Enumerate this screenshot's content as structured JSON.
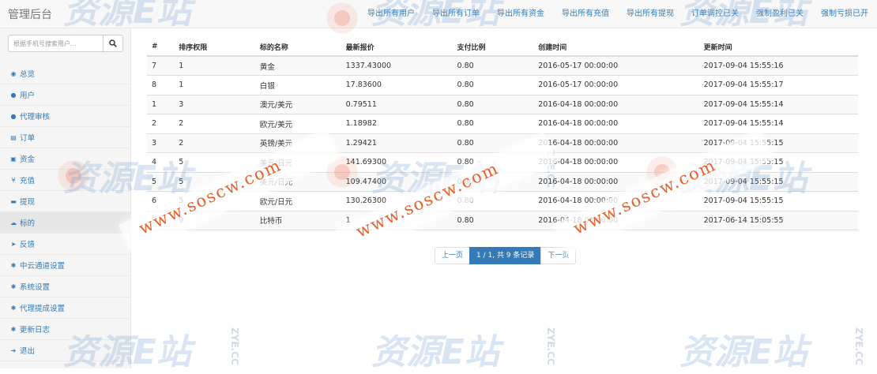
{
  "app": {
    "title": "管理后台"
  },
  "topnav": [
    {
      "label": "导出所有用户"
    },
    {
      "label": "导出所有订单"
    },
    {
      "label": "导出所有资金"
    },
    {
      "label": "导出所有充值"
    },
    {
      "label": "导出所有提现"
    },
    {
      "label": "订单调控已关"
    },
    {
      "label": "强制盈利已关"
    },
    {
      "label": "强制亏损已开"
    }
  ],
  "search": {
    "placeholder": "根据手机号搜索用户...",
    "icon": "search-icon"
  },
  "sidebar": {
    "items": [
      {
        "label": "总览",
        "icon": "dashboard-icon",
        "glyph": "◉"
      },
      {
        "label": "用户",
        "icon": "user-icon",
        "glyph": "●"
      },
      {
        "label": "代理审核",
        "icon": "user-icon",
        "glyph": "●"
      },
      {
        "label": "订单",
        "icon": "list-icon",
        "glyph": "▤"
      },
      {
        "label": "资金",
        "icon": "money-icon",
        "glyph": "▣"
      },
      {
        "label": "充值",
        "icon": "yen-icon",
        "glyph": "¥"
      },
      {
        "label": "提现",
        "icon": "briefcase-icon",
        "glyph": "▬"
      },
      {
        "label": "标的",
        "icon": "cloud-icon",
        "glyph": "☁"
      },
      {
        "label": "反馈",
        "icon": "send-icon",
        "glyph": "➤"
      },
      {
        "label": "中云通道设置",
        "icon": "settings-icon",
        "glyph": "✱"
      },
      {
        "label": "系统设置",
        "icon": "settings-icon",
        "glyph": "✱"
      },
      {
        "label": "代理提成设置",
        "icon": "settings-icon",
        "glyph": "✱"
      },
      {
        "label": "更新日志",
        "icon": "settings-icon",
        "glyph": "✱"
      },
      {
        "label": "退出",
        "icon": "logout-icon",
        "glyph": "➜"
      }
    ],
    "active_index": 7
  },
  "table": {
    "headers": [
      "#",
      "排序权限",
      "标的名称",
      "最新报价",
      "支付比例",
      "创建时间",
      "更新时间"
    ],
    "rows": [
      [
        "7",
        "1",
        "黄金",
        "1337.43000",
        "0.80",
        "2016-05-17 00:00:00",
        "2017-09-04 15:55:16"
      ],
      [
        "8",
        "1",
        "白银",
        "17.83600",
        "0.80",
        "2016-05-17 00:00:00",
        "2017-09-04 15:55:17"
      ],
      [
        "1",
        "3",
        "澳元/美元",
        "0.79511",
        "0.80",
        "2016-04-18 00:00:00",
        "2017-09-04 15:55:14"
      ],
      [
        "2",
        "2",
        "欧元/美元",
        "1.18982",
        "0.80",
        "2016-04-18 00:00:00",
        "2017-09-04 15:55:14"
      ],
      [
        "3",
        "2",
        "英镑/美元",
        "1.29421",
        "0.80",
        "2016-04-18 00:00:00",
        "2017-09-04 15:55:15"
      ],
      [
        "4",
        "5",
        "美元/日元",
        "141.69300",
        "0.80",
        "2016-04-18 00:00:00",
        "2017-09-04 15:55:15"
      ],
      [
        "5",
        "5",
        "美元/日元",
        "109.47400",
        "0.80",
        "2016-04-18 00:00:00",
        "2017-09-04 15:55:15"
      ],
      [
        "6",
        "5",
        "欧元/日元",
        "130.26300",
        "0.80",
        "2016-04-18 00:00:00",
        "2017-09-04 15:55:15"
      ],
      [
        "9",
        "9",
        "比特币",
        "1",
        "0.80",
        "2016-04-18 00:00:00",
        "2017-06-14 15:05:55"
      ]
    ]
  },
  "pagination": {
    "prev": "上一页",
    "current": "1 / 1, 共 9 条记录",
    "next": "下一页"
  },
  "watermark": {
    "url": "www.soscw.com",
    "logo": "资源E站",
    "side": "ZYE.CC"
  },
  "colors": {
    "link": "#337ab7",
    "watermark_url": "#e8602a"
  }
}
